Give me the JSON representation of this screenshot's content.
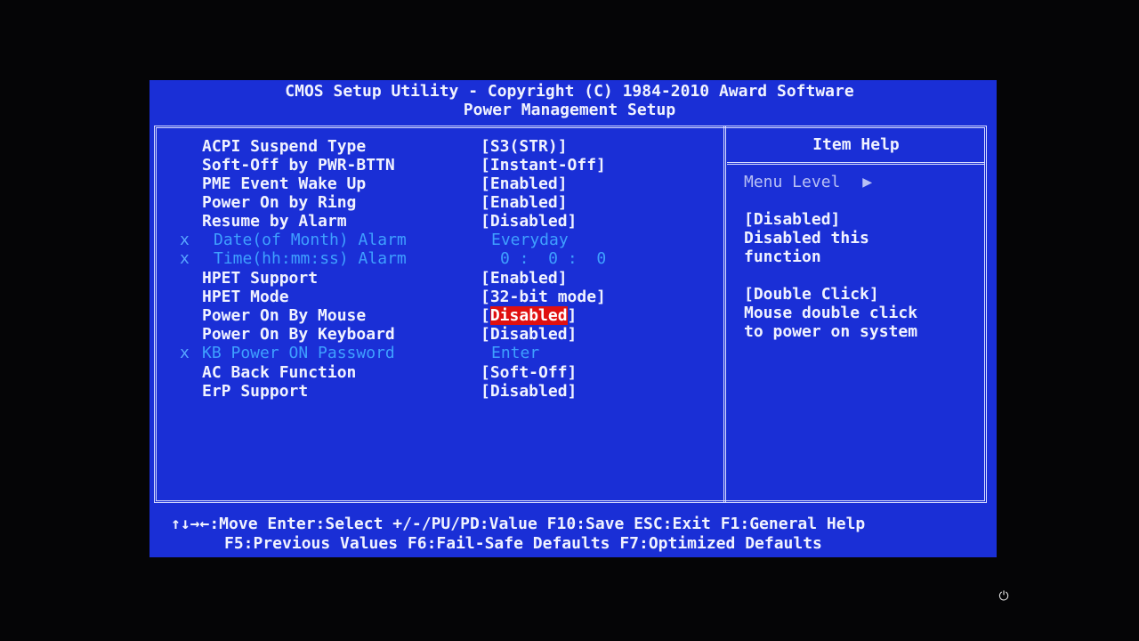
{
  "header": {
    "line1": "CMOS Setup Utility - Copyright (C) 1984-2010 Award Software",
    "line2": "Power Management Setup"
  },
  "settings": [
    {
      "label": "ACPI Suspend Type",
      "value": "[S3(STR)]",
      "disabled": false
    },
    {
      "label": "Soft-Off by PWR-BTTN",
      "value": "[Instant-Off]",
      "disabled": false
    },
    {
      "label": "PME Event Wake Up",
      "value": "[Enabled]",
      "disabled": false
    },
    {
      "label": "Power On by Ring",
      "value": "[Enabled]",
      "disabled": false
    },
    {
      "label": "Resume by Alarm",
      "value": "[Disabled]",
      "disabled": false
    },
    {
      "label": "Date(of Month) Alarm",
      "value": "Everyday",
      "disabled": true,
      "mark": "x"
    },
    {
      "label": "Time(hh:mm:ss) Alarm",
      "value": "0 :  0 :  0",
      "disabled": true,
      "mark": "x"
    },
    {
      "label": "HPET Support",
      "value": "[Enabled]",
      "disabled": false
    },
    {
      "label": "HPET Mode",
      "value": "[32-bit mode]",
      "disabled": false
    },
    {
      "label": "Power On By Mouse",
      "value": "[Disabled]",
      "disabled": false,
      "selected": true,
      "value_open": "[",
      "value_inner": "Disabled",
      "value_close": "]"
    },
    {
      "label": "Power On By Keyboard",
      "value": "[Disabled]",
      "disabled": false
    },
    {
      "label": "KB Power ON Password",
      "value": "Enter",
      "disabled": true,
      "mark": "x"
    },
    {
      "label": "AC Back Function",
      "value": "[Soft-Off]",
      "disabled": false
    },
    {
      "label": "ErP Support",
      "value": "[Disabled]",
      "disabled": false
    }
  ],
  "help": {
    "title": "Item Help",
    "menu_level": "Menu Level",
    "menu_level_arrow": "▶",
    "lines": [
      "[Disabled]",
      "Disabled this",
      "function",
      "",
      "[Double Click]",
      "Mouse double click",
      "to power on system"
    ]
  },
  "footer": {
    "line1": "↑↓→←:Move  Enter:Select  +/-/PU/PD:Value  F10:Save  ESC:Exit  F1:General Help",
    "line2": "F5:Previous Values  F6:Fail-Safe Defaults  F7:Optimized Defaults"
  },
  "colors": {
    "background": "#1a2fd6",
    "text": "#f0f2ff",
    "disabled_text": "#3fa0ff",
    "highlight": "#e01010"
  },
  "icons": {
    "power": "power-icon"
  }
}
